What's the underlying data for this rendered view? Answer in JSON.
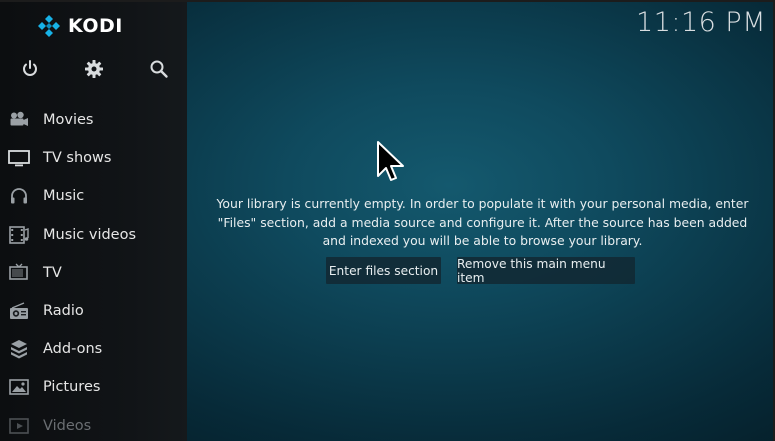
{
  "app": {
    "logo_text": "KODI",
    "clock": "11:16 PM"
  },
  "top_icons": [
    "power-icon",
    "gear-icon",
    "search-icon"
  ],
  "menu": {
    "items": [
      {
        "label": "Movies",
        "icon": "movie-camera-icon"
      },
      {
        "label": "TV shows",
        "icon": "tv-icon"
      },
      {
        "label": "Music",
        "icon": "headphones-icon"
      },
      {
        "label": "Music videos",
        "icon": "film-strip-icon"
      },
      {
        "label": "TV",
        "icon": "television-icon"
      },
      {
        "label": "Radio",
        "icon": "radio-icon"
      },
      {
        "label": "Add-ons",
        "icon": "addons-icon"
      },
      {
        "label": "Pictures",
        "icon": "picture-icon"
      },
      {
        "label": "Videos",
        "icon": "video-icon"
      }
    ]
  },
  "main": {
    "message": "Your library is currently empty. In order to populate it with your personal media, enter \"Files\" section, add a media source and configure it. After the source has been added and indexed you will be able to browse your library.",
    "enter_button": "Enter files section",
    "remove_button": "Remove this main menu item"
  },
  "colors": {
    "background": "#0f4a5e",
    "sidebar": "#111417",
    "logo_accent": "#17b2e7"
  }
}
